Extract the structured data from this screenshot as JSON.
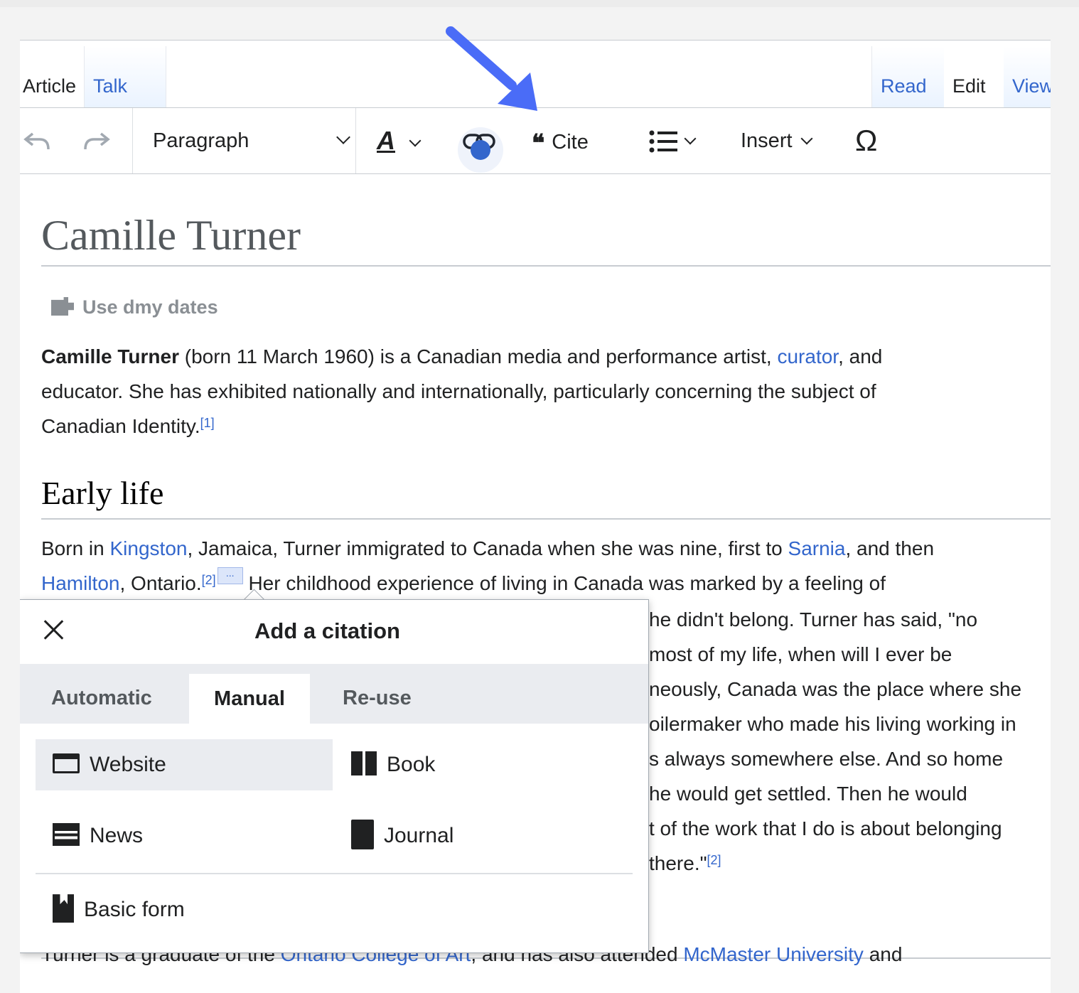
{
  "tabs": {
    "article": "Article",
    "talk": "Talk",
    "read": "Read",
    "edit": "Edit",
    "view": "View"
  },
  "toolbar": {
    "undo_icon": "undo-icon",
    "redo_icon": "redo-icon",
    "paragraph": "Paragraph",
    "text_style_icon": "A",
    "link_icon": "link-icon",
    "cite_mark": "❝",
    "cite": "Cite",
    "list_icon": "list-icon",
    "insert": "Insert",
    "special_char": "Ω"
  },
  "article": {
    "title": "Camille Turner",
    "meta": "Use dmy dates",
    "intro": {
      "bold": "Camille Turner",
      "t1": " (born 11 March 1960) is a Canadian media and performance artist, ",
      "link1": "curator",
      "t2": ", and",
      "line2": "educator. She has exhibited nationally and internationally, particularly concerning the subject of",
      "line3": "Canadian Identity.",
      "ref1": "[1]"
    },
    "section": "Early life",
    "early": {
      "a1": "Born in ",
      "kingston": "Kingston",
      "a2": ", Jamaica, Turner immigrated to Canada when she was nine, first to ",
      "sarnia": "Sarnia",
      "a3": ", and then",
      "hamilton": "Hamilton",
      "b2": ", Ontario.",
      "ref2": "[2]",
      "ellipsis": "...",
      "b3": " Her childhood experience of living in Canada was marked by a feeling of",
      "r1": "he didn't belong. Turner has said, \"no",
      "r2": "most of my life, when will I ever be",
      "r3": "neously, Canada was the place where she",
      "r4": "oilermaker who made his living working in",
      "r5": "s always somewhere else. And so home",
      "r6": "he would get settled. Then he would",
      "r7": "t of the work that I do is about belonging",
      "r8": "there.\"",
      "ref3": "[2]"
    },
    "bottom": {
      "t1": "Turner is a graduate of the ",
      "ocad": "Ontario College of Art",
      "t2": ", and has also attended ",
      "mcmaster": "McMaster University",
      "t3": " and"
    }
  },
  "citation_popup": {
    "title": "Add a citation",
    "tabs": [
      "Automatic",
      "Manual",
      "Re-use"
    ],
    "active_tab": "Manual",
    "options": {
      "website": "Website",
      "book": "Book",
      "news": "News",
      "journal": "Journal",
      "basic": "Basic form"
    }
  },
  "colors": {
    "link": "#3366cc",
    "arrow": "#4a6cf7"
  }
}
